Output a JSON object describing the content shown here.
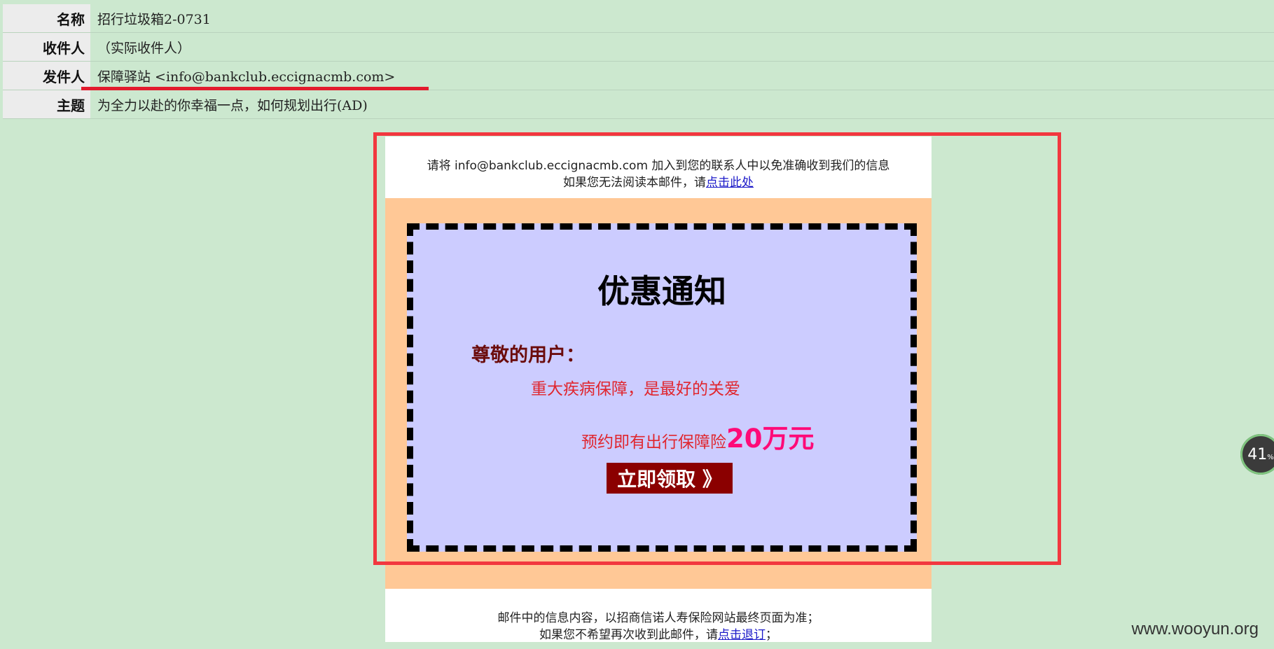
{
  "header": {
    "rows": [
      {
        "key": "名称",
        "value": "招行垃圾箱2-0731"
      },
      {
        "key": "收件人",
        "value": "（实际收件人）"
      },
      {
        "key": "发件人",
        "value": "保障驿站 <info@bankclub.eccignacmb.com>"
      },
      {
        "key": "主题",
        "value": "为全力以赴的你幸福一点，如何规划出行(AD)"
      }
    ]
  },
  "email": {
    "top_line1": "请将 info@bankclub.eccignacmb.com  加入到您的联系人中以免准确收到我们的信息",
    "top_line2_prefix": "如果您无法阅读本邮件，请",
    "top_line2_link": "点击此处",
    "promo": {
      "title": "优惠通知",
      "greeting": "尊敬的用户：",
      "line1": "重大疾病保障，是最好的关爱",
      "line2_prefix": "预约即有出行保障险",
      "line2_amount": "20万元",
      "button_label": "立即领取 》"
    },
    "bottom_line1": "邮件中的信息内容，以招商信诺人寿保险网站最终页面为准；",
    "bottom_line2_prefix": "如果您不希望再次收到此邮件，请",
    "bottom_line2_link": "点击退订",
    "bottom_line2_suffix": "；"
  },
  "watermark": "www.wooyun.org",
  "speed_badge": {
    "value": "41",
    "unit": "%"
  },
  "colors": {
    "background": "#cce8cf",
    "highlight": "#f2373f",
    "promo_bg": "#ffc896",
    "card_bg": "#ccccff",
    "button_bg": "#8b0000"
  }
}
